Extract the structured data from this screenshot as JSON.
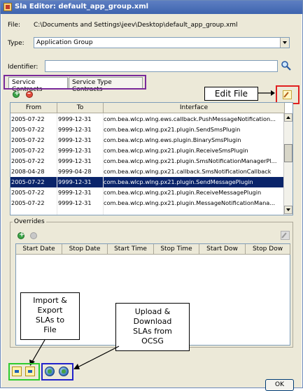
{
  "window": {
    "title": "Sla Editor: default_app_group.xml"
  },
  "file": {
    "label": "File:",
    "value": "C:\\Documents and Settings\\jeev\\Desktop\\default_app_group.xml"
  },
  "type": {
    "label": "Type:",
    "value": "Application Group"
  },
  "identifier": {
    "label": "Identifier:",
    "value": ""
  },
  "tabs": [
    {
      "label": "Service Contracts",
      "active": true
    },
    {
      "label": "Service Type Contracts",
      "active": false
    }
  ],
  "contracts": {
    "columns": [
      "From",
      "To",
      "Interface"
    ],
    "rows": [
      {
        "from": "2005-07-22",
        "to": "9999-12-31",
        "interface": "com.bea.wlcp.wlng.ews.callback.PushMessageNotification...",
        "selected": false
      },
      {
        "from": "2005-07-22",
        "to": "9999-12-31",
        "interface": "com.bea.wlcp.wlng.px21.plugin.SendSmsPlugin",
        "selected": false
      },
      {
        "from": "2005-07-22",
        "to": "9999-12-31",
        "interface": "com.bea.wlcp.wlng.ews.plugin.BinarySmsPlugin",
        "selected": false
      },
      {
        "from": "2005-07-22",
        "to": "9999-12-31",
        "interface": "com.bea.wlcp.wlng.px21.plugin.ReceiveSmsPlugin",
        "selected": false
      },
      {
        "from": "2005-07-22",
        "to": "9999-12-31",
        "interface": "com.bea.wlcp.wlng.px21.plugin.SmsNotificationManagerPl...",
        "selected": false
      },
      {
        "from": "2008-04-28",
        "to": "9999-04-28",
        "interface": "com.bea.wlcp.wlng.px21.callback.SmsNotificationCallback",
        "selected": false
      },
      {
        "from": "2005-07-22",
        "to": "9999-12-31",
        "interface": "com.bea.wlcp.wlng.px21.plugin.SendMessagePlugin",
        "selected": true
      },
      {
        "from": "2005-07-22",
        "to": "9999-12-31",
        "interface": "com.bea.wlcp.wlng.px21.plugin.ReceiveMessagePlugin",
        "selected": false
      },
      {
        "from": "2005-07-22",
        "to": "9999-12-31",
        "interface": "com.bea.wlcp.wlng.px21.plugin.MessageNotificationMana...",
        "selected": false
      }
    ]
  },
  "overrides": {
    "legend": "Overrides",
    "columns": [
      "Start Date",
      "Stop Date",
      "Start Time",
      "Stop Time",
      "Start Dow",
      "Stop Dow"
    ]
  },
  "callouts": {
    "edit_file": "Edit File",
    "import_export": [
      "Import &",
      "Export",
      "SLAs to",
      "File"
    ],
    "upload_download": [
      "Upload &",
      "Download",
      "SLAs from",
      "OCSG"
    ]
  },
  "buttons": {
    "ok": "OK"
  },
  "colors": {
    "titlebar": "#3e64ae",
    "selection": "#0a246a",
    "red_box": "#e02020",
    "green_box": "#2ecc2e",
    "blue_box": "#2222cc",
    "purple_box": "#7a2a9a"
  }
}
